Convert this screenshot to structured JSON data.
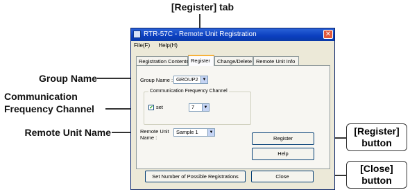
{
  "callouts": {
    "register_tab": "[Register] tab",
    "group_name": "Group Name",
    "comm_freq_line1": "Communication",
    "comm_freq_line2": "Frequency Channel",
    "remote_unit_name": "Remote Unit Name",
    "register_button_line1": "[Register]",
    "register_button_line2": "button",
    "close_button_line1": "[Close]",
    "close_button_line2": "button"
  },
  "window": {
    "title": "RTR-57C - Remote Unit Registration",
    "close_glyph": "✕",
    "menu": [
      "File(F)",
      "Help(H)"
    ]
  },
  "tabs": [
    "Registration Contents",
    "Register",
    "Change/Delete",
    "Remote Unit Info"
  ],
  "active_tab": "Register",
  "form": {
    "group_name_label": "Group Name :",
    "group_name_value": "GROUP2",
    "comm_group_label": "Communication Frequency Channel",
    "set_label": "set",
    "set_checked": true,
    "checkmark": "✔",
    "channel_value": "7",
    "remote_unit_label_line1": "Remote Unit",
    "remote_unit_label_line2": "Name :",
    "remote_unit_value": "Sample 1",
    "dropdown_arrow": "▼"
  },
  "buttons": {
    "register": "Register",
    "help": "Help",
    "set_number": "Set Number of Possible Registrations",
    "close": "Close"
  }
}
